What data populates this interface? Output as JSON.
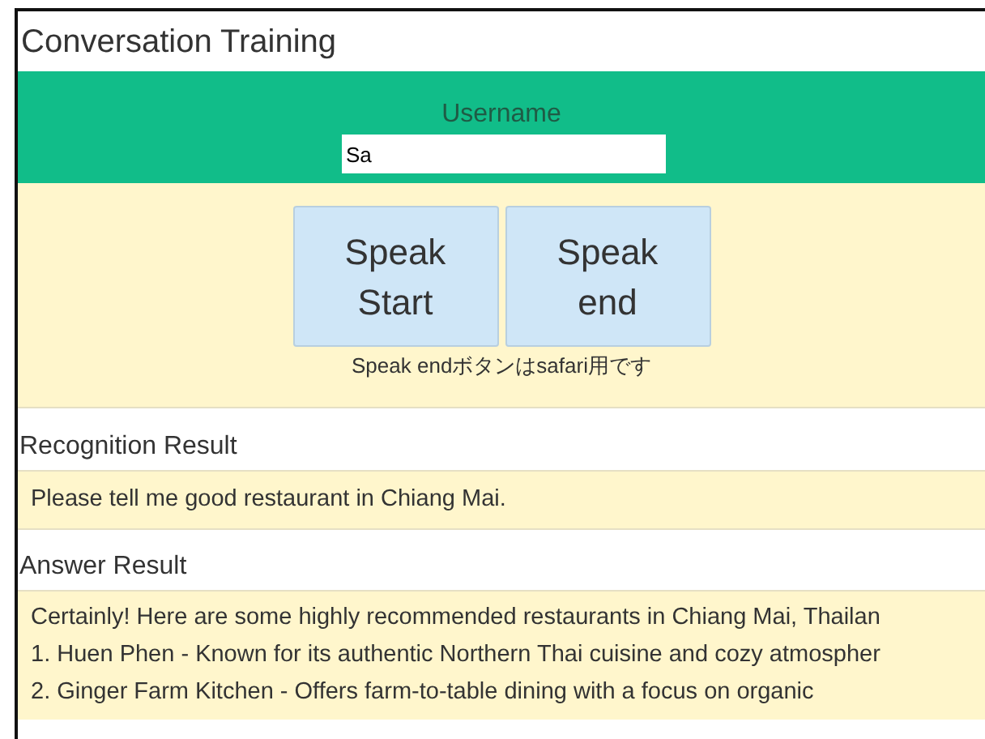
{
  "title": "Conversation Training",
  "username": {
    "label": "Username",
    "value": "Sa"
  },
  "buttons": [
    {
      "line1": "Speak",
      "line2": "Start"
    },
    {
      "line1": "Speak",
      "line2": "end"
    }
  ],
  "note": "Speak endボタンはsafari用です",
  "recognition": {
    "heading": "Recognition Result",
    "text": "Please tell me good restaurant in Chiang Mai."
  },
  "answer": {
    "heading": "Answer Result",
    "lines": [
      "Certainly! Here are some highly recommended restaurants in Chiang Mai, Thailan",
      "1. Huen Phen - Known for its authentic Northern Thai cuisine and cozy atmospher",
      "2. Ginger Farm Kitchen - Offers farm-to-table dining with a focus on organic"
    ]
  }
}
